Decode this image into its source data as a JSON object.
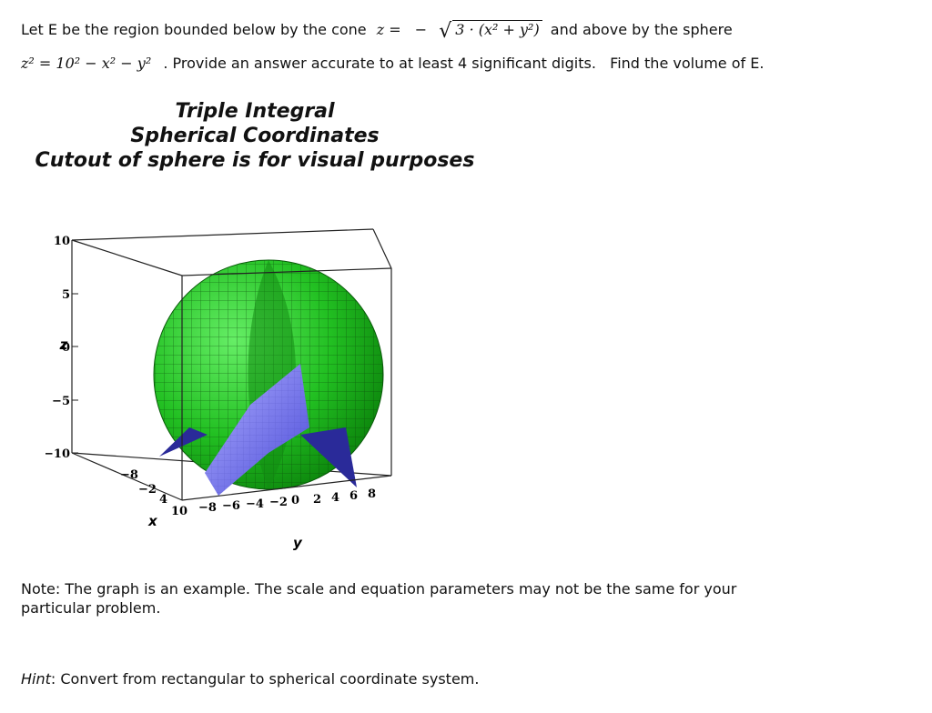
{
  "problem": {
    "line1_prefix": "Let E be the region bounded below by the cone",
    "cone_lhs": "z =",
    "cone_sign": "−",
    "cone_radicand": "3 · (x² + y²)",
    "line1_suffix": "and above by the sphere",
    "sphere_eq": "z² = 10² − x² − y²",
    "line2_suffix": ". Provide an answer accurate to at least 4 significant digits.   Find the volume of E."
  },
  "figure": {
    "title_line1": "Triple Integral",
    "title_line2": "Spherical Coordinates",
    "title_line3": "Cutout of sphere is for visual purposes",
    "z_label": "z",
    "x_label": "x",
    "y_label": "y",
    "z_ticks": [
      "10",
      "5",
      "0",
      "−5",
      "−10"
    ],
    "x_ticks": [
      "−8",
      "−2",
      "4",
      "10"
    ],
    "y_ticks": [
      "−8",
      "−6",
      "−4",
      "−2",
      "0",
      "2",
      "4",
      "6",
      "8"
    ],
    "colors": {
      "sphere": "#22cc22",
      "sphere_dark": "#118811",
      "cone": "#7777ee",
      "cone_dark": "#2a2a99"
    }
  },
  "note": {
    "text": "Note:  The graph is an example.  The scale and equation parameters may not be the same for your particular problem."
  },
  "hint": {
    "label": "Hint",
    "text": ": Convert from rectangular to spherical coordinate system."
  }
}
